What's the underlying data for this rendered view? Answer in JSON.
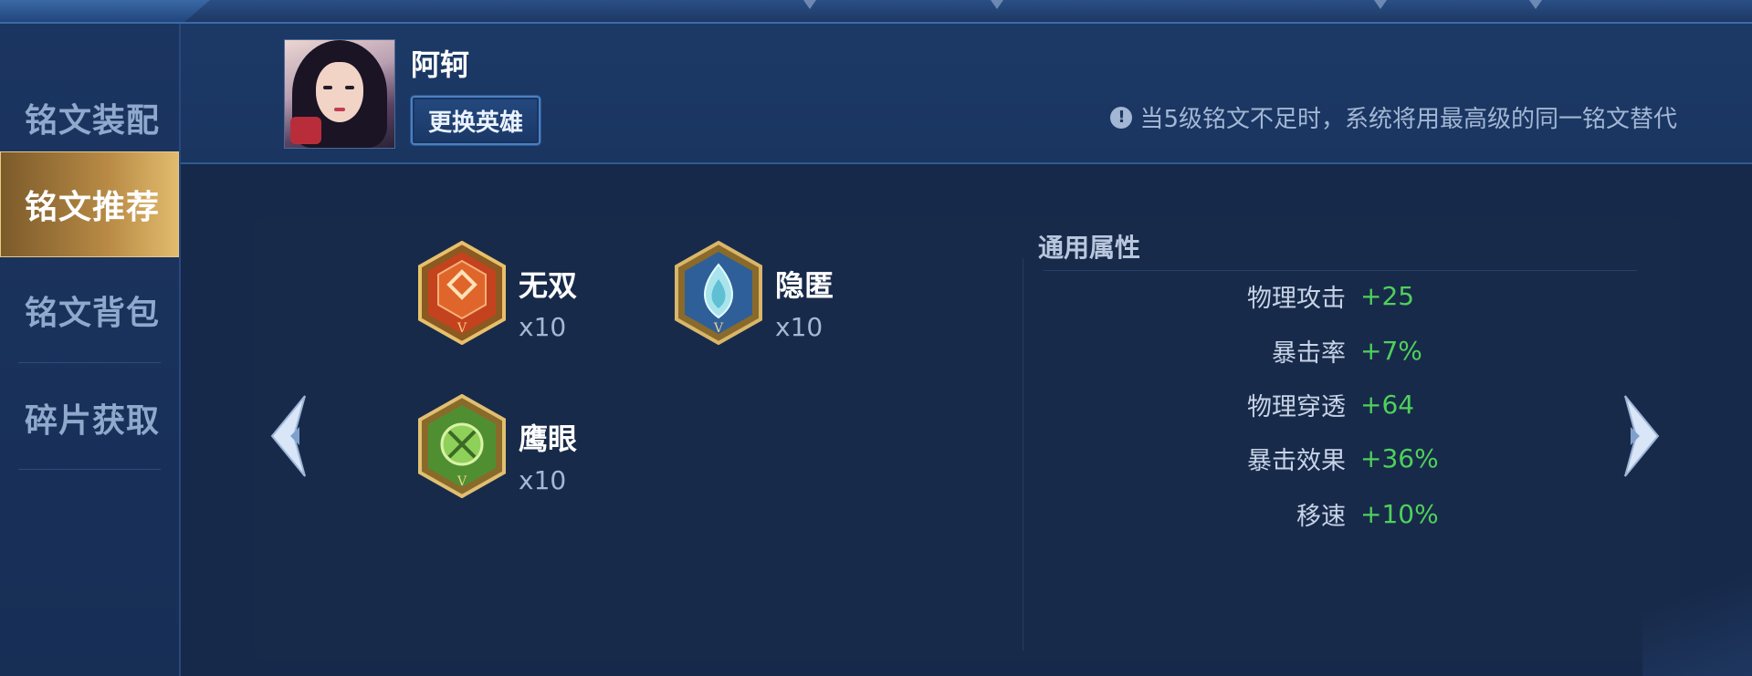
{
  "sidebar": {
    "items": [
      {
        "label": "铭文装配",
        "active": false
      },
      {
        "label": "铭文推荐",
        "active": true
      },
      {
        "label": "铭文背包",
        "active": false
      },
      {
        "label": "碎片获取",
        "active": false
      }
    ]
  },
  "header": {
    "hero_name": "阿轲",
    "change_hero_label": "更换英雄",
    "notice_text": "当5级铭文不足时，系统将用最高级的同一铭文替代",
    "notice_icon": "!"
  },
  "runes": [
    {
      "name": "无双",
      "count": "x10",
      "color": "#c4421d",
      "icon": "red-rune-icon",
      "level": "V"
    },
    {
      "name": "隐匿",
      "count": "x10",
      "color": "#3d79b8",
      "icon": "blue-rune-icon",
      "level": "V"
    },
    {
      "name": "鹰眼",
      "count": "x10",
      "color": "#5faa3a",
      "icon": "green-rune-icon",
      "level": "V"
    }
  ],
  "attributes": {
    "title": "通用属性",
    "rows": [
      {
        "name": "物理攻击",
        "value": "+25"
      },
      {
        "name": "暴击率",
        "value": "+7%"
      },
      {
        "name": "物理穿透",
        "value": "+64"
      },
      {
        "name": "暴击效果",
        "value": "+36%"
      },
      {
        "name": "移速",
        "value": "+10%"
      }
    ]
  },
  "nav": {
    "prev_icon": "chevron-left-icon",
    "next_icon": "chevron-right-icon"
  },
  "colors": {
    "accent_gold": "#e2bc6e",
    "value_green": "#4ed15a",
    "panel_bg": "#182a4a"
  }
}
